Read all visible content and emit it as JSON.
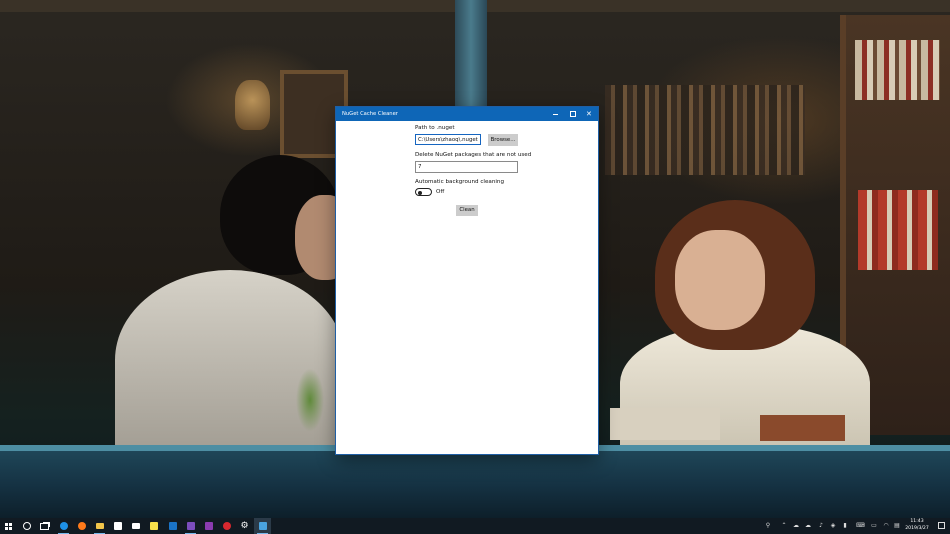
{
  "window": {
    "title": "NuGet Cache Cleaner",
    "controls": {
      "minimize": "minimize-icon",
      "maximize": "maximize-icon",
      "close": "close-icon"
    }
  },
  "form": {
    "path_label": "Path to .nuget",
    "path_value": "C:\\Users\\zhaoq\\.nuget",
    "browse_label": "Browse...",
    "delete_label": "Delete NuGet packages that are not used",
    "days_value": "7",
    "auto_label": "Automatic background cleaning",
    "auto_state": "Off",
    "auto_enabled": false,
    "clean_label": "Clean"
  },
  "taskbar": {
    "apps": [
      {
        "name": "start",
        "icon": "windows-icon"
      },
      {
        "name": "cortana",
        "icon": "cortana-icon"
      },
      {
        "name": "task-view",
        "icon": "task-view-icon"
      },
      {
        "name": "edge",
        "icon": "edge-icon",
        "color": "#1e90e6"
      },
      {
        "name": "firefox",
        "icon": "firefox-icon",
        "color": "#ff7a1a"
      },
      {
        "name": "file-explorer",
        "icon": "folder-icon",
        "color": "#f2c54a"
      },
      {
        "name": "store",
        "icon": "store-icon",
        "color": "#ffffff"
      },
      {
        "name": "mail",
        "icon": "mail-icon",
        "color": "#ffffff"
      },
      {
        "name": "sticky-notes",
        "icon": "sticky-notes-icon",
        "color": "#f7e14b"
      },
      {
        "name": "outlook",
        "icon": "outlook-icon",
        "color": "#1a73c7"
      },
      {
        "name": "visual-studio",
        "icon": "visual-studio-icon",
        "color": "#7c4dbd"
      },
      {
        "name": "onenote",
        "icon": "onenote-icon",
        "color": "#8b3bb0"
      },
      {
        "name": "red-app",
        "icon": "red-app-icon",
        "color": "#d8282f"
      },
      {
        "name": "settings",
        "icon": "gear-icon",
        "color": "#ffffff"
      },
      {
        "name": "nuget-cache-cleaner",
        "icon": "nuget-icon",
        "color": "#4aa3df"
      }
    ],
    "tray_icons": [
      "people-icon",
      "chevron-up-icon",
      "cloud-icon",
      "onedrive-icon",
      "volume-icon",
      "network-icon",
      "battery-icon",
      "keyboard-icon",
      "display-icon",
      "wifi-icon",
      "input-icon"
    ],
    "clock_time": "11:43",
    "clock_date": "2019/3/27"
  }
}
